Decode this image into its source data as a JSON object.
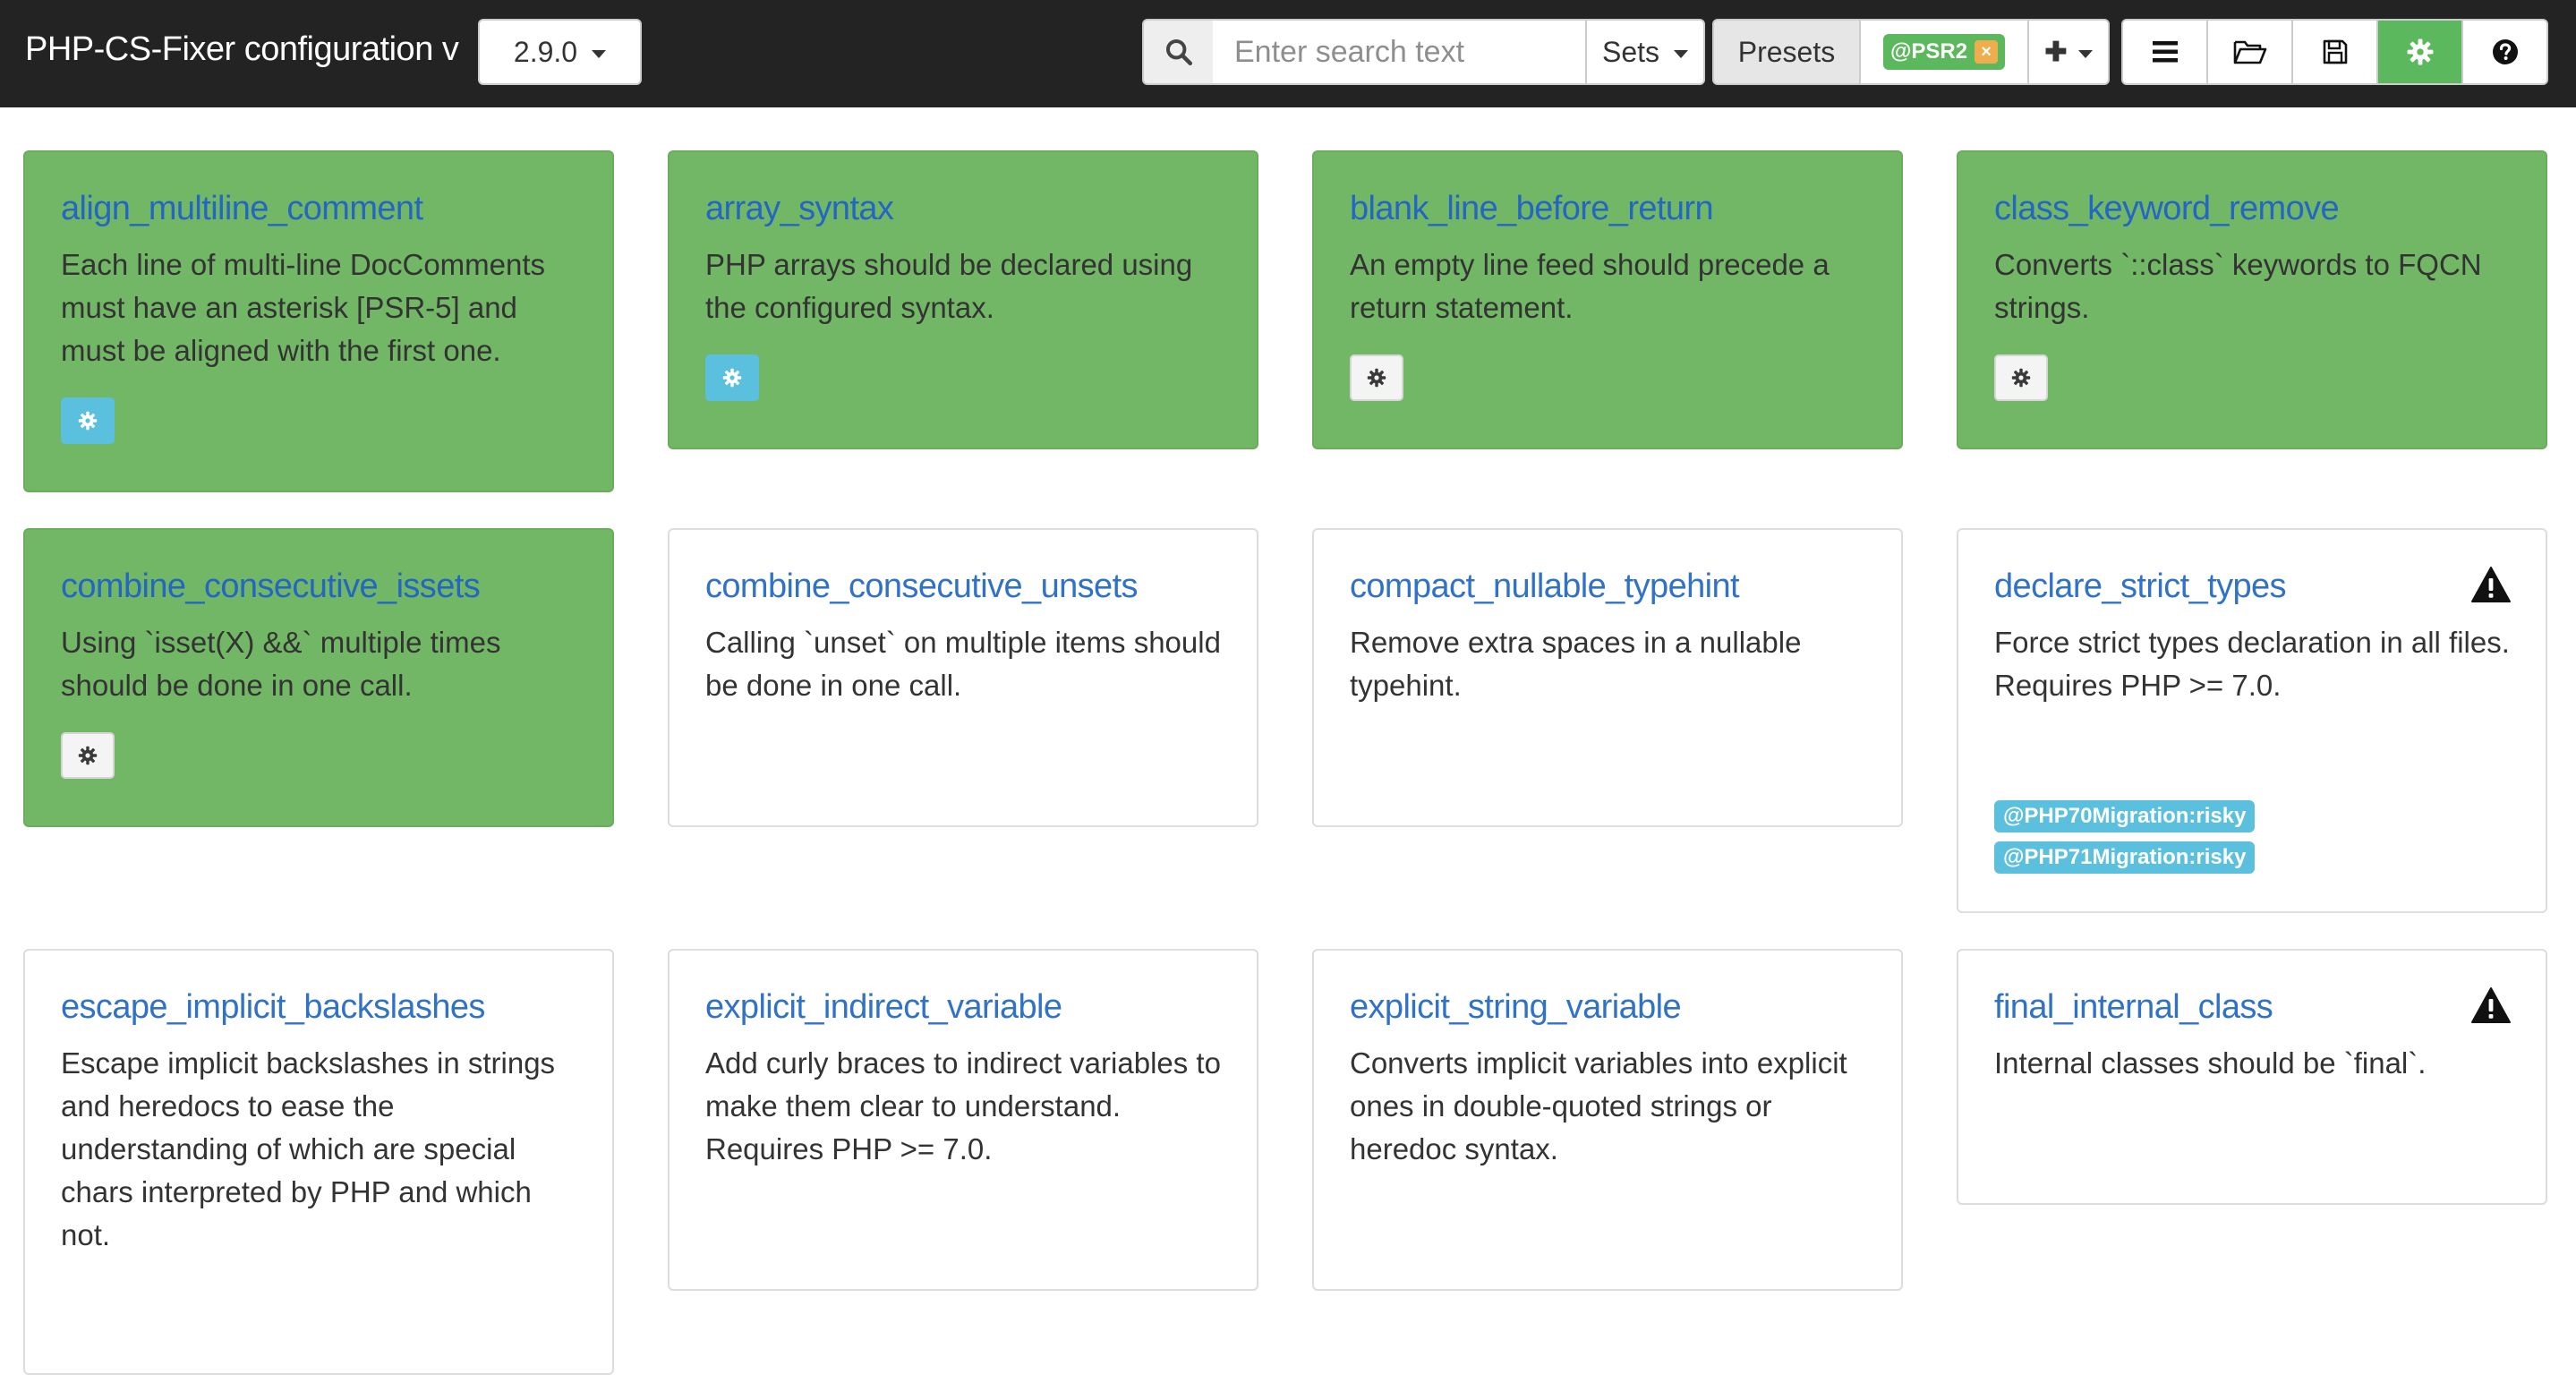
{
  "navbar": {
    "brand": "PHP-CS-Fixer configuration v",
    "version": "2.9.0",
    "search_placeholder": "Enter search text",
    "sets_label": "Sets",
    "presets_label": "Presets",
    "active_preset": "@PSR2",
    "remove_symbol": "×",
    "add_symbol": "✚",
    "tools": [
      "list-icon",
      "folder-open-icon",
      "save-icon",
      "gear-icon",
      "question-icon"
    ]
  },
  "colors": {
    "navbar": "#232323",
    "enabled_card": "#72b765",
    "link": "#2f72c8",
    "success": "#5cb85c",
    "info": "#5bc0de",
    "warning": "#f0ad4e"
  },
  "rules": [
    {
      "name": "align_multiline_comment",
      "description": "Each line of multi-line DocComments must have an asterisk [PSR-5] and must be aligned with the first one.",
      "enabled": true,
      "configurable": true,
      "configured": true,
      "risky": false,
      "sets": []
    },
    {
      "name": "array_syntax",
      "description": "PHP arrays should be declared using the configured syntax.",
      "enabled": true,
      "configurable": true,
      "configured": true,
      "risky": false,
      "sets": []
    },
    {
      "name": "blank_line_before_return",
      "description": "An empty line feed should precede a return statement.",
      "enabled": true,
      "configurable": true,
      "configured": false,
      "risky": false,
      "sets": []
    },
    {
      "name": "class_keyword_remove",
      "description": "Converts `::class` keywords to FQCN strings.",
      "enabled": true,
      "configurable": true,
      "configured": false,
      "risky": false,
      "sets": []
    },
    {
      "name": "combine_consecutive_issets",
      "description": "Using `isset(X) &&` multiple times should be done in one call.",
      "enabled": true,
      "configurable": true,
      "configured": false,
      "risky": false,
      "sets": []
    },
    {
      "name": "combine_consecutive_unsets",
      "description": "Calling `unset` on multiple items should be done in one call.",
      "enabled": false,
      "configurable": false,
      "configured": false,
      "risky": false,
      "sets": []
    },
    {
      "name": "compact_nullable_typehint",
      "description": "Remove extra spaces in a nullable typehint.",
      "enabled": false,
      "configurable": false,
      "configured": false,
      "risky": false,
      "sets": []
    },
    {
      "name": "declare_strict_types",
      "description": "Force strict types declaration in all files. Requires PHP >= 7.0.",
      "enabled": false,
      "configurable": false,
      "configured": false,
      "risky": true,
      "sets": [
        "@PHP70Migration:risky",
        "@PHP71Migration:risky"
      ]
    },
    {
      "name": "escape_implicit_backslashes",
      "description": "Escape implicit backslashes in strings and heredocs to ease the understanding of which are special chars interpreted by PHP and which not.",
      "enabled": false,
      "configurable": false,
      "configured": false,
      "risky": false,
      "sets": []
    },
    {
      "name": "explicit_indirect_variable",
      "description": "Add curly braces to indirect variables to make them clear to understand. Requires PHP >= 7.0.",
      "enabled": false,
      "configurable": false,
      "configured": false,
      "risky": false,
      "sets": []
    },
    {
      "name": "explicit_string_variable",
      "description": "Converts implicit variables into explicit ones in double-quoted strings or heredoc syntax.",
      "enabled": false,
      "configurable": false,
      "configured": false,
      "risky": false,
      "sets": []
    },
    {
      "name": "final_internal_class",
      "description": "Internal classes should be `final`.",
      "enabled": false,
      "configurable": false,
      "configured": false,
      "risky": true,
      "sets": []
    }
  ]
}
